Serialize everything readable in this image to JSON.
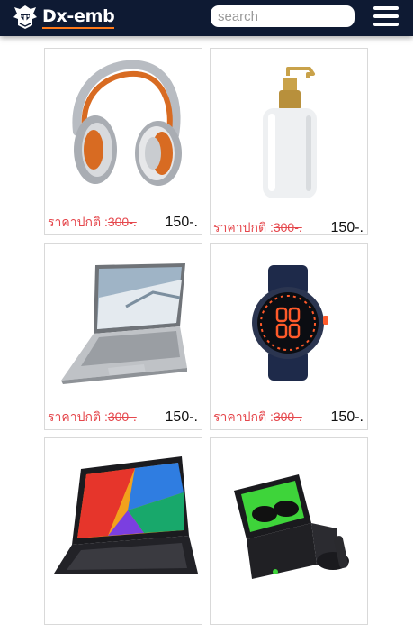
{
  "header": {
    "brand": "Dx-emb",
    "search_placeholder": "search",
    "logo_icon": "warrior-helmet-logo",
    "menu_icon": "hamburger-menu-icon",
    "bg_color": "#0e1a33",
    "accent_color": "#ff7a1a"
  },
  "products": [
    {
      "image": "headphones",
      "price_label": "ราคาปกติ :",
      "old_price": "300-.",
      "new_price": "150-."
    },
    {
      "image": "pump-bottle",
      "price_label": "ราคาปกติ :",
      "old_price": "300-.",
      "new_price": "150-."
    },
    {
      "image": "laptop-silver",
      "price_label": "ราคาปกติ :",
      "old_price": "300-.",
      "new_price": "150-."
    },
    {
      "image": "smartwatch",
      "price_label": "ราคาปกติ :",
      "old_price": "300-.",
      "new_price": "150-."
    },
    {
      "image": "laptop-colorful",
      "price_label": "",
      "old_price": "",
      "new_price": ""
    },
    {
      "image": "wireless-earbuds",
      "price_label": "",
      "old_price": "",
      "new_price": ""
    }
  ]
}
